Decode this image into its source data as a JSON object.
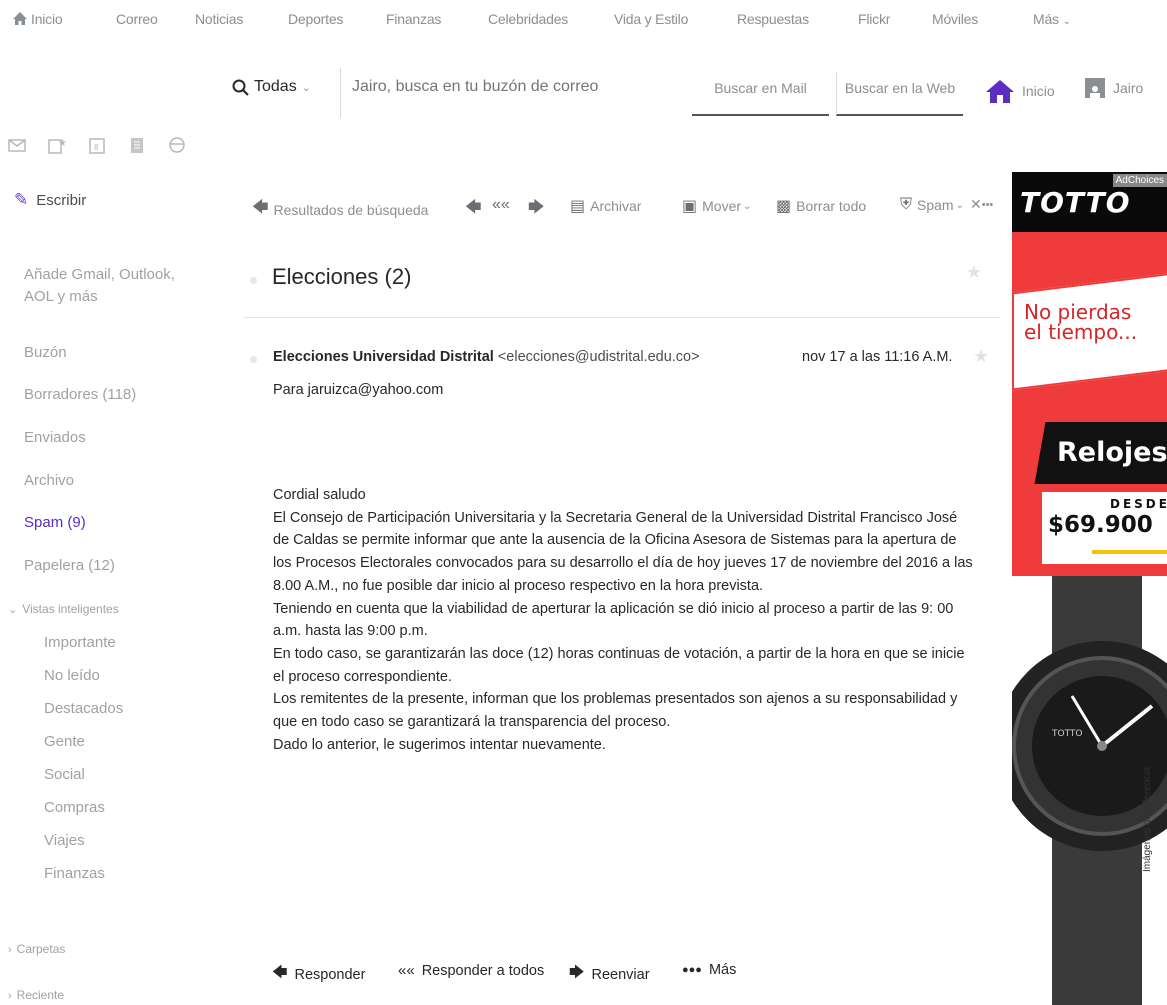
{
  "topnav": {
    "items": [
      "Inicio",
      "Correo",
      "Noticias",
      "Deportes",
      "Finanzas",
      "Celebridades",
      "Vida y Estilo",
      "Respuestas",
      "Flickr",
      "Móviles",
      "Más"
    ]
  },
  "search": {
    "scope": "Todas",
    "value": "Jairo, busca en tu buzón de correo",
    "mail_button": "Buscar en Mail",
    "web_button": "Buscar en la Web",
    "home_label": "Inicio",
    "user_name": "Jairo"
  },
  "sidebar": {
    "compose": "Escribir",
    "add_accounts": [
      "Añade Gmail, Outlook,",
      "AOL y más"
    ],
    "folders": [
      "Buzón",
      "Borradores (118)",
      "Enviados",
      "Archivo",
      "Spam (9)",
      "Papelera (12)"
    ],
    "smart_views_header": "Vistas inteligentes",
    "smart_views": [
      "Importante",
      "No leído",
      "Destacados",
      "Gente",
      "Social",
      "Compras",
      "Viajes",
      "Finanzas"
    ],
    "folders_header": "Carpetas",
    "recent_header": "Reciente"
  },
  "toolbar": {
    "back": "Resultados de búsqueda",
    "archive": "Archivar",
    "move": "Mover",
    "delete_all": "Borrar todo",
    "spam": "Spam",
    "more": "•••"
  },
  "email": {
    "subject": "Elecciones (2)",
    "sender_name": "Elecciones Universidad Distrital",
    "sender_email": "<elecciones@udistrital.edu.co>",
    "date": "nov 17 a las 11:16 A.M.",
    "to": "Para  jaruizca@yahoo.com",
    "body": [
      "Cordial saludo",
      "El Consejo de Participación Universitaria y la Secretaria General de la Universidad Distrital Francisco José de Caldas se permite informar que ante la ausencia de la Oficina Asesora de Sistemas para la apertura de los Procesos Electorales convocados para su desarrollo el día de hoy jueves 17 de noviembre del 2016 a las 8.00 A.M., no fue posible dar inicio al proceso respectivo en la hora prevista.",
      "Teniendo en cuenta que la viabilidad de aperturar la aplicación se dió inicio al proceso a partir de las 9: 00 a.m. hasta las 9:00 p.m.",
      "En todo caso, se garantizarán las doce (12) horas continuas de votación, a partir de la hora en que se inicie el proceso correspondiente.",
      "Los remitentes de la presente, informan que los problemas presentados son ajenos a su responsabilidad y que en todo caso se garantizará la transparencia del proceso.",
      "Dado lo anterior, le sugerimos intentar nuevamente."
    ]
  },
  "actions": {
    "reply": "Responder",
    "reply_all": "Responder a todos",
    "forward": "Reenviar",
    "more": "Más"
  },
  "ad": {
    "brand": "TOTTO",
    "adchoices": "AdChoices",
    "headline": [
      "No pierdas",
      "el tiempo..."
    ],
    "product": "Relojes",
    "desde": "DESDE",
    "price": "$69.900",
    "watch_brand": "TOTTO",
    "footnote": "Imágenes de referencia",
    "color": "#ef3b3b"
  },
  "colors": {
    "accent": "#5a2cc0",
    "muted_text": "#9ea2a6"
  }
}
